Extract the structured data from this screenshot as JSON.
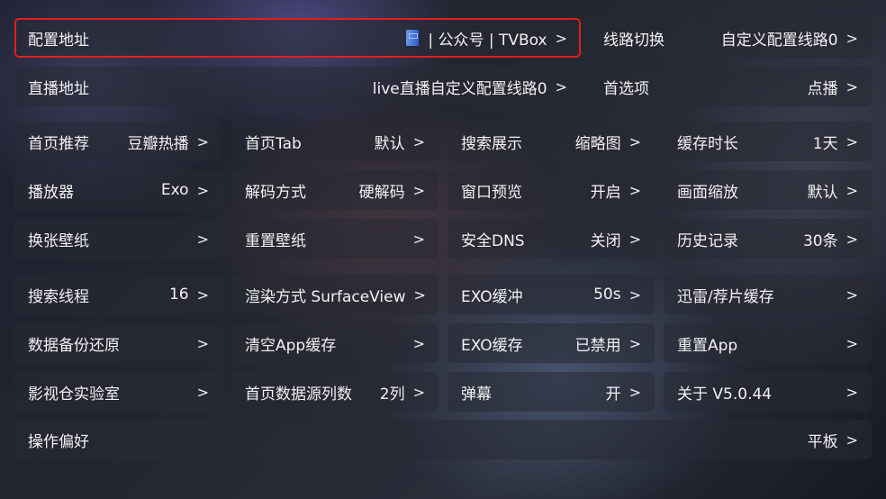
{
  "rows": [
    [
      {
        "label": "配置地址",
        "value": "| 公众号 | TVBox",
        "icon": "book-icon",
        "focused": true
      },
      {
        "label": "线路切换",
        "value": "自定义配置线路0"
      }
    ],
    [
      {
        "label": "直播地址",
        "value": "live直播自定义配置线路0"
      },
      {
        "label": "首选项",
        "value": "点播"
      }
    ],
    [
      {
        "label": "首页推荐",
        "value": "豆瓣热播"
      },
      {
        "label": "首页Tab",
        "value": "默认"
      },
      {
        "label": "搜索展示",
        "value": "缩略图"
      },
      {
        "label": "缓存时长",
        "value": "1天"
      }
    ],
    [
      {
        "label": "播放器",
        "value": "Exo"
      },
      {
        "label": "解码方式",
        "value": "硬解码"
      },
      {
        "label": "窗口预览",
        "value": "开启"
      },
      {
        "label": "画面缩放",
        "value": "默认"
      }
    ],
    [
      {
        "label": "换张壁纸",
        "value": ""
      },
      {
        "label": "重置壁纸",
        "value": ""
      },
      {
        "label": "安全DNS",
        "value": "关闭"
      },
      {
        "label": "历史记录",
        "value": "30条"
      }
    ],
    [
      {
        "label": "搜索线程",
        "value": "16"
      },
      {
        "label": "渲染方式 SurfaceView",
        "value": ""
      },
      {
        "label": "EXO缓冲",
        "value": "50s"
      },
      {
        "label": "迅雷/荐片缓存",
        "value": ""
      }
    ],
    [
      {
        "label": "数据备份还原",
        "value": ""
      },
      {
        "label": "清空App缓存",
        "value": ""
      },
      {
        "label": "EXO缓存",
        "value": "已禁用"
      },
      {
        "label": "重置App",
        "value": ""
      }
    ],
    [
      {
        "label": "影视仓实验室",
        "value": ""
      },
      {
        "label": "首页数据源列数",
        "value": "2列"
      },
      {
        "label": "弹幕",
        "value": "开"
      },
      {
        "label": "关于  V5.0.44",
        "value": ""
      }
    ],
    [
      {
        "label": "操作偏好",
        "value": "平板"
      }
    ]
  ],
  "chevron": ">",
  "colors": {
    "focus_border": "#e0201c"
  }
}
